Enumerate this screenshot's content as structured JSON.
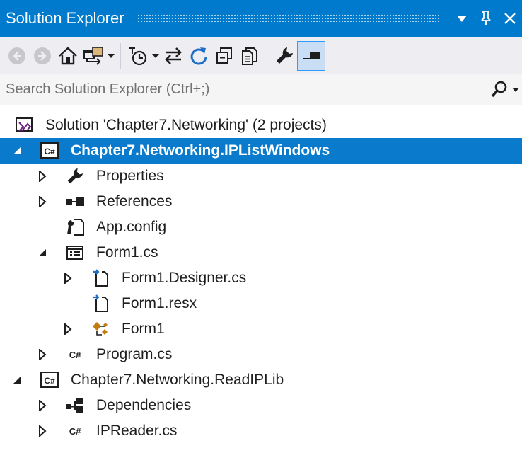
{
  "window": {
    "title": "Solution Explorer"
  },
  "search": {
    "placeholder": "Search Solution Explorer (Ctrl+;)"
  },
  "tree": {
    "solution": {
      "label": "Solution 'Chapter7.Networking' (2 projects)"
    },
    "project1": {
      "label": "Chapter7.Networking.IPListWindows",
      "icon": "csharp-project-icon",
      "properties": "Properties",
      "references": "References",
      "appconfig": "App.config",
      "form1": "Form1.cs",
      "form1_designer": "Form1.Designer.cs",
      "form1_resx": "Form1.resx",
      "form1_class": "Form1",
      "program": "Program.cs"
    },
    "project2": {
      "label": "Chapter7.Networking.ReadIPLib",
      "dependencies": "Dependencies",
      "ipreader": "IPReader.cs"
    }
  },
  "colors": {
    "accent": "#007acc",
    "selected_row": "#0a7acc",
    "toolbar_bg": "#eeeef2"
  }
}
